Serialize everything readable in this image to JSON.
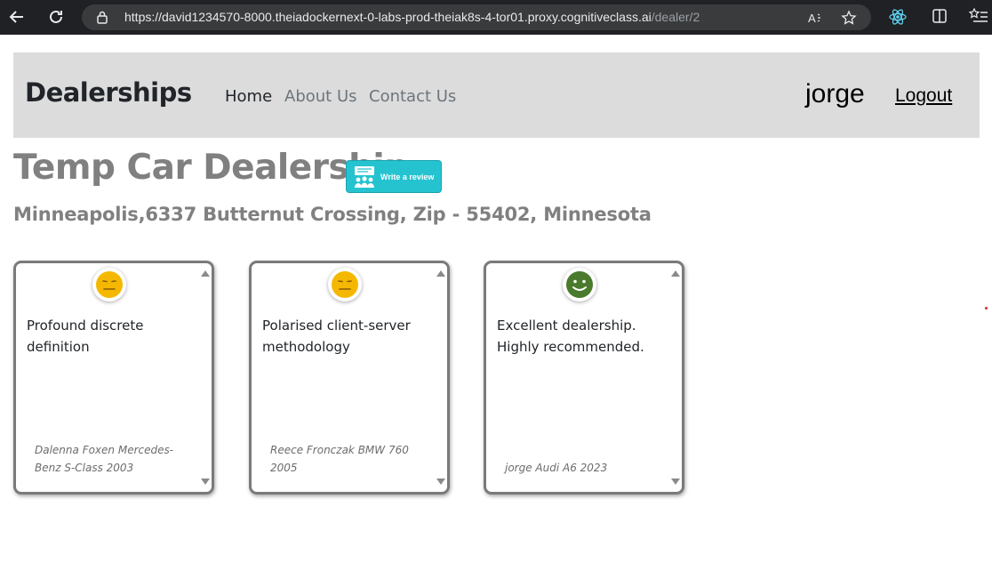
{
  "browser": {
    "url_host": "https://david1234570-8000.theiadockernext-0-labs-prod-theiak8s-4-tor01.proxy.cognitiveclass.ai",
    "url_path": "/dealer/2",
    "back_icon": "arrow-left-icon",
    "refresh_icon": "refresh-icon",
    "lock_icon": "lock-icon",
    "read_aloud_icon": "read-aloud-icon",
    "favorite_icon": "star-icon",
    "extension_icon": "react-icon",
    "split_icon": "split-screen-icon",
    "favorites_icon": "favorites-list-icon"
  },
  "navbar": {
    "brand": "Dealerships",
    "links": [
      {
        "label": "Home",
        "active": true
      },
      {
        "label": "About Us",
        "active": false
      },
      {
        "label": "Contact Us",
        "active": false
      }
    ],
    "user": "jorge",
    "logout": "Logout"
  },
  "dealer": {
    "name": "Temp Car Dealership",
    "address": "Minneapolis,6337 Butternut Crossing, Zip - 55402, Minnesota",
    "review_button_label": "Write a review",
    "review_button_icon": "people-review-icon"
  },
  "reviews": [
    {
      "text": "Profound discrete definition",
      "meta": "Dalenna Foxen Mercedes-Benz S-Class 2003",
      "sentiment": "neutral",
      "sentiment_icon": "neutral-face-icon",
      "color": "#f5b800"
    },
    {
      "text": "Polarised client-server methodology",
      "meta": "Reece Fronczak BMW 760 2005",
      "sentiment": "neutral",
      "sentiment_icon": "neutral-face-icon",
      "color": "#f5b800"
    },
    {
      "text": "Excellent dealership. Highly recommended.",
      "meta": "jorge Audi A6 2023",
      "sentiment": "positive",
      "sentiment_icon": "smiley-face-icon",
      "color": "#4a7a2c"
    }
  ]
}
